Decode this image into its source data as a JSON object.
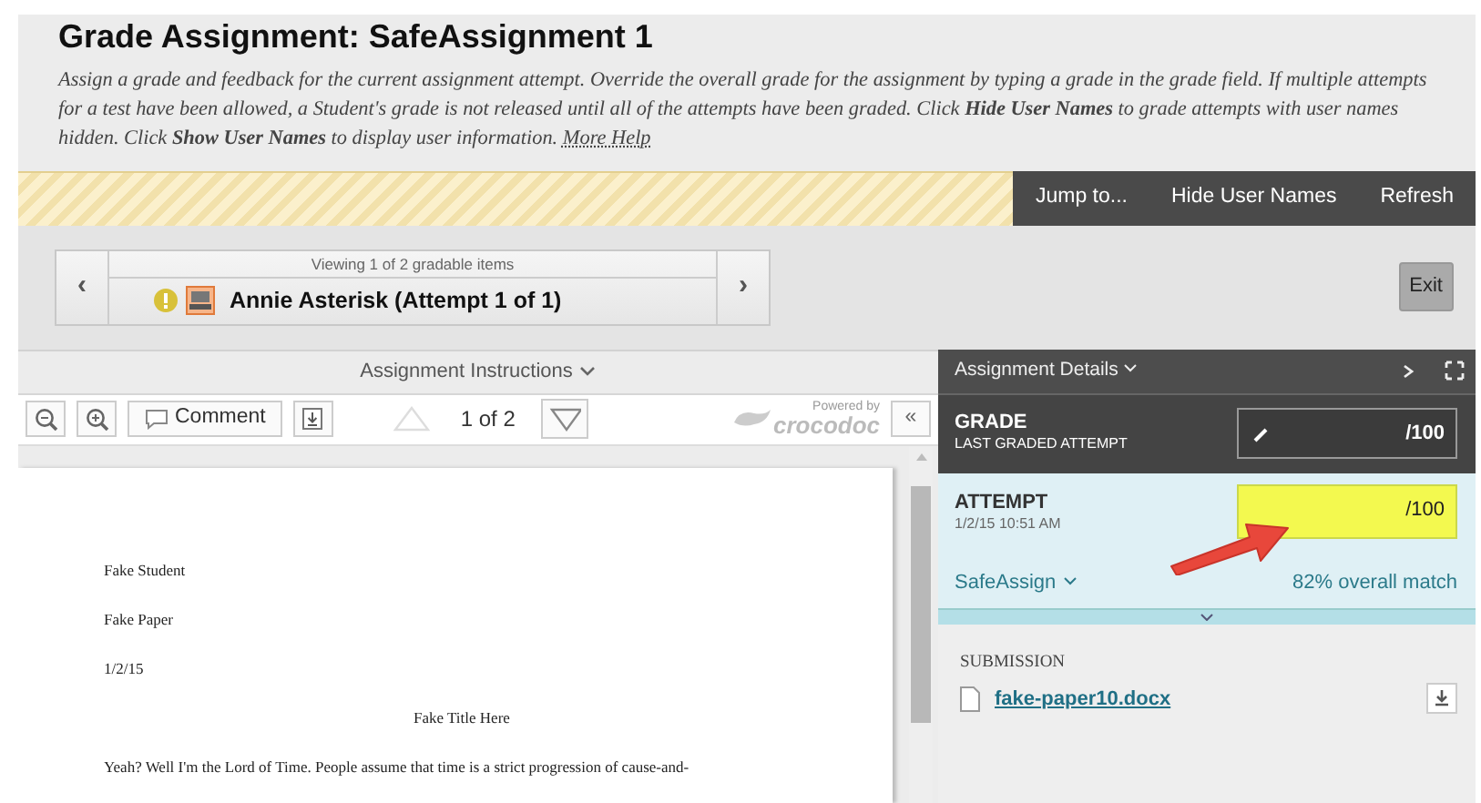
{
  "page_title": "Grade Assignment: SafeAssignment 1",
  "description": "Assign a grade and feedback for the current assignment attempt. Override the overall grade for the assignment by typing a grade in the grade field. If multiple attempts for a test have been allowed, a Student's grade is not released until all of the attempts have been graded. Click **Hide User Names** to grade attempts with user names hidden. Click **Show User Names** to display user information.",
  "help_link": "More Help",
  "action_bar": [
    "Jump to...",
    "Hide User Names",
    "Refresh"
  ],
  "navigator": {
    "prev": "‹",
    "next": "›",
    "status": "Viewing 1 of 2 gradable items",
    "student": "Annie Asterisk (Attempt 1 of 1)"
  },
  "exit_button": "Exit",
  "instructions_toggle": "Assignment Instructions",
  "viewer_toolbar": {
    "comment": "Comment",
    "page": "1 of 2",
    "powered_by": "Powered by",
    "brand": "crocodoc",
    "collapse": "«"
  },
  "document": [
    {
      "kind": "left",
      "text": "Fake Student"
    },
    {
      "kind": "left",
      "text": "Fake Paper"
    },
    {
      "kind": "left",
      "text": "1/2/15"
    },
    {
      "kind": "center",
      "text": "Fake Title Here"
    },
    {
      "kind": "left",
      "text": "Yeah? Well I'm the Lord of Time. People assume that time is a strict progression of cause-and-"
    }
  ],
  "details": {
    "header": "Assignment Details",
    "grade": {
      "label": "GRADE",
      "sub": "LAST GRADED ATTEMPT",
      "suffix": "/100"
    },
    "attempt": {
      "label": "ATTEMPT",
      "date": "1/2/15 10:51 AM",
      "suffix": "/100",
      "safeassign": "SafeAssign",
      "match": "82% overall match"
    },
    "submission": {
      "label": "SUBMISSION",
      "file": "fake-paper10.docx"
    }
  }
}
